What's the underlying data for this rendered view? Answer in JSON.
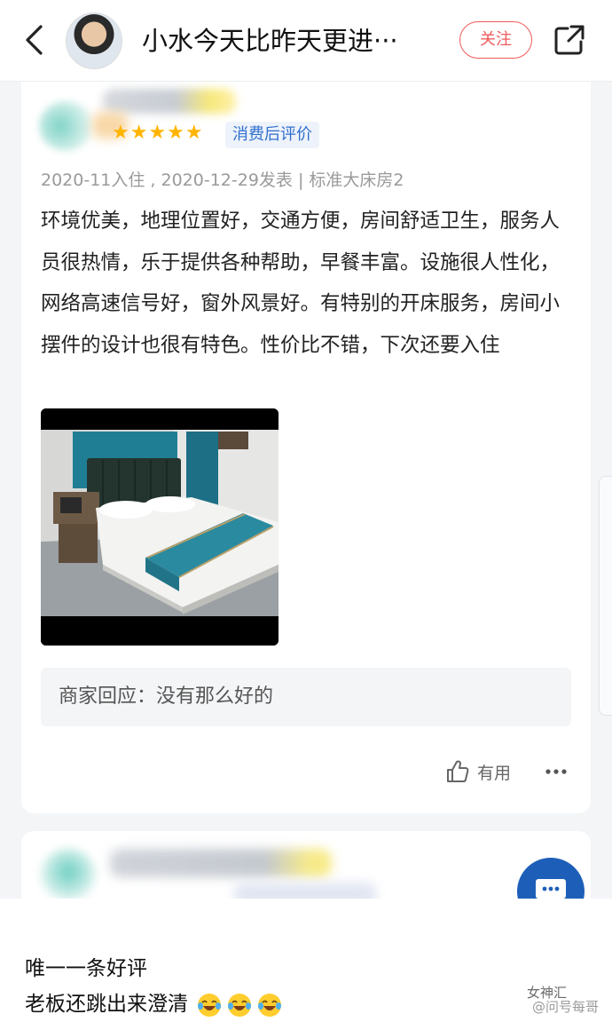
{
  "header": {
    "title": "小水今天比昨天更进···",
    "follow_label": "关注"
  },
  "review": {
    "stars": "★★★★★",
    "tag": "消费后评价",
    "meta": "2020-11入住 , 2020-12-29发表 | 标准大床房2",
    "text": "环境优美，地理位置好，交通方便，房间舒适卫生，服务人员很热情，乐于提供各种帮助，早餐丰富。设施很人性化，网络高速信号好，窗外风景好。有特别的开床服务，房间小摆件的设计也很有特色。性价比不错，下次还要入住",
    "merchant_reply": "商家回应：没有那么好的",
    "useful_label": "有用"
  },
  "caption": {
    "line1": "唯一一条好评",
    "line2": "老板还跳出来澄清"
  },
  "watermark": {
    "line1": "女神汇",
    "line2": "@问号每哥"
  },
  "colors": {
    "accent_red": "#f05a5a",
    "star": "#ffb400",
    "tag_blue": "#2f6fce",
    "fab_blue": "#1d5fb8"
  }
}
